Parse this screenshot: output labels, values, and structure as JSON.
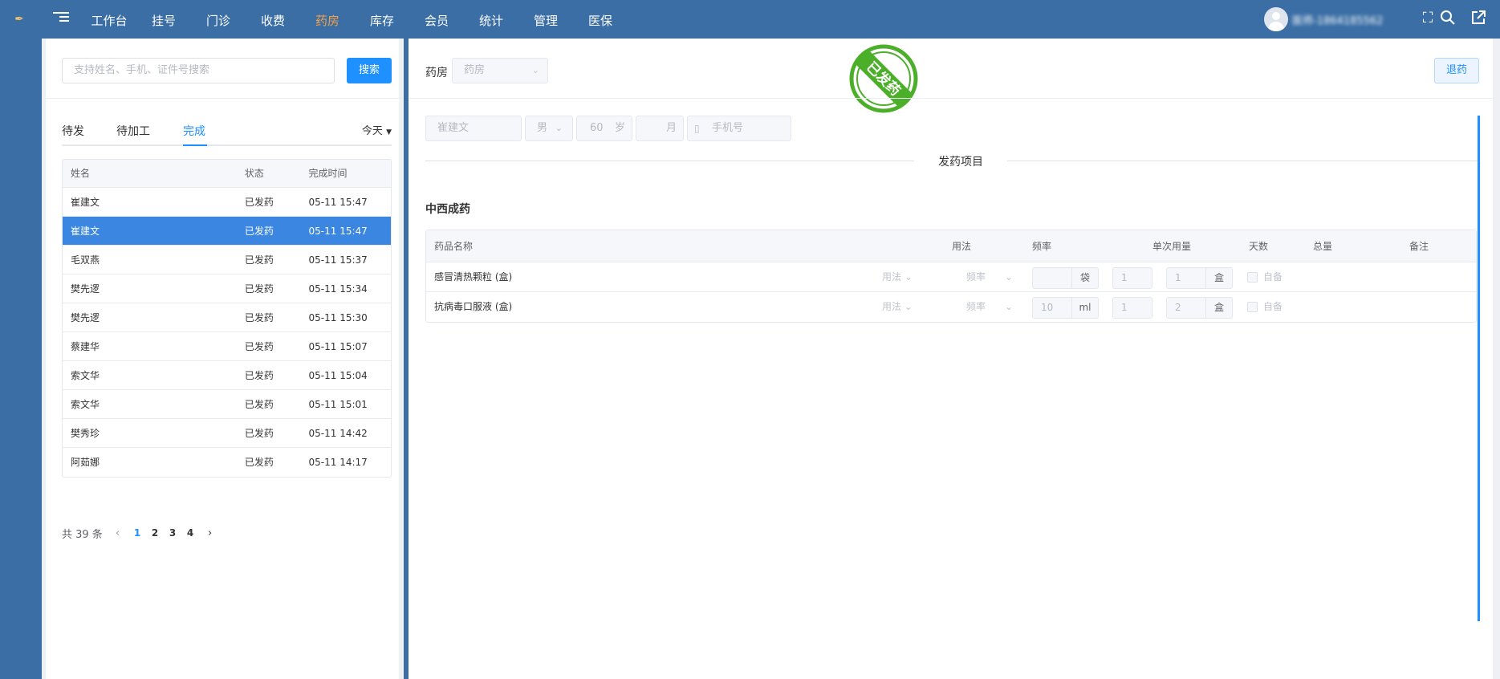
{
  "nav": {
    "items": [
      "工作台",
      "挂号",
      "门诊",
      "收费",
      "药房",
      "库存",
      "会员",
      "统计",
      "管理",
      "医保"
    ],
    "active_index": 4
  },
  "user": {
    "name": "医师-1864185562"
  },
  "icons": {
    "logo": "brand-logo-icon",
    "menu": "menu-toggle-icon",
    "fullscreen": "fullscreen-icon",
    "search": "search-icon",
    "external": "external-link-icon"
  },
  "left": {
    "search_placeholder": "支持姓名、手机、证件号搜索",
    "search_button": "搜索",
    "tabs": [
      "待发",
      "待加工",
      "完成"
    ],
    "active_tab": 2,
    "date_filter": "今天",
    "columns": [
      "姓名",
      "状态",
      "完成时间"
    ],
    "rows": [
      {
        "name": "崔建文",
        "status": "已发药",
        "time": "05-11 15:47"
      },
      {
        "name": "崔建文",
        "status": "已发药",
        "time": "05-11 15:47"
      },
      {
        "name": "毛双燕",
        "status": "已发药",
        "time": "05-11 15:37"
      },
      {
        "name": "樊先逻",
        "status": "已发药",
        "time": "05-11 15:34"
      },
      {
        "name": "樊先逻",
        "status": "已发药",
        "time": "05-11 15:30"
      },
      {
        "name": "蔡建华",
        "status": "已发药",
        "time": "05-11 15:07"
      },
      {
        "name": "索文华",
        "status": "已发药",
        "time": "05-11 15:04"
      },
      {
        "name": "索文华",
        "status": "已发药",
        "time": "05-11 15:01"
      },
      {
        "name": "樊秀珍",
        "status": "已发药",
        "time": "05-11 14:42"
      },
      {
        "name": "阿茹娜",
        "status": "已发药",
        "time": "05-11 14:17"
      }
    ],
    "selected_row": 1,
    "pager": {
      "total": "共 39 条",
      "pages": [
        "1",
        "2",
        "3",
        "4"
      ],
      "current": 0
    }
  },
  "right": {
    "pharmacy_label": "药房",
    "pharmacy_select": "药房",
    "return_button": "退药",
    "stamp_text": "已发药",
    "patient": {
      "name": "崔建文",
      "gender": "男",
      "age": "60",
      "age_unit": "岁",
      "month_unit": "月",
      "phone_placeholder": "手机号"
    },
    "section_title": "发药项目",
    "group_title": "中西成药",
    "columns": [
      "药品名称",
      "用法",
      "频率",
      "单次用量",
      "天数",
      "总量",
      "备注"
    ],
    "drugs": [
      {
        "name": "感冒清热颗粒 (盒)",
        "usage": "用法",
        "freq": "频率",
        "dose": "",
        "dose_unit": "袋",
        "days": "1",
        "total": "1",
        "total_unit": "盒",
        "self_label": "自备"
      },
      {
        "name": "抗病毒口服液 (盒)",
        "usage": "用法",
        "freq": "频率",
        "dose": "10",
        "dose_unit": "ml",
        "days": "1",
        "total": "2",
        "total_unit": "盒",
        "self_label": "自备"
      }
    ]
  },
  "colors": {
    "topbar": "#3a6ea5",
    "accent": "#1e90ff",
    "nav_active": "#f5a04a",
    "stamp": "#4caf2a"
  }
}
